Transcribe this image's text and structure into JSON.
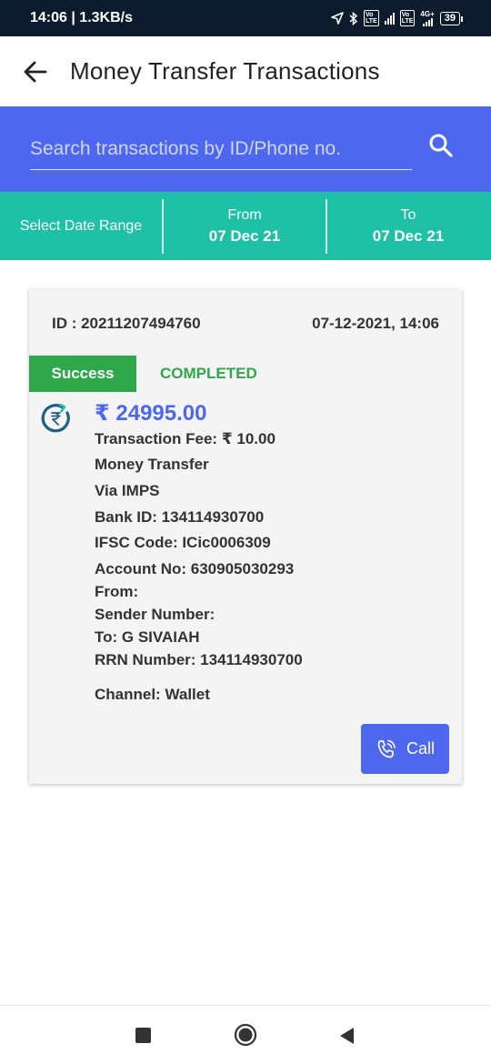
{
  "status_bar": {
    "time_speed": "14:06 | 1.3KB/s",
    "volte1": "Vo LTE",
    "net_4g": "4G+",
    "battery": "39"
  },
  "app_bar": {
    "title": "Money Transfer Transactions",
    "back_icon": "arrow-left-icon"
  },
  "search": {
    "placeholder": "Search transactions by ID/Phone no.",
    "value": "",
    "icon": "search-icon"
  },
  "date_range": {
    "select_label": "Select Date Range",
    "from_label": "From",
    "from_value": "07 Dec 21",
    "to_label": "To",
    "to_value": "07 Dec 21"
  },
  "transaction": {
    "id": "ID : 20211207494760",
    "datetime": "07-12-2021, 14:06",
    "status_badge": "Success",
    "status_text": "COMPLETED",
    "amount": "₹ 24995.00",
    "fee": "Transaction Fee: ₹ 10.00",
    "type": "Money Transfer",
    "via": "Via  IMPS",
    "bank_id": "Bank ID:  134114930700",
    "ifsc": "IFSC Code:  ICic0006309",
    "account": "Account No: 630905030293",
    "from": "From:",
    "sender": "Sender Number:",
    "to": "To:  G SIVAIAH",
    "rrn": "RRN Number:  134114930700",
    "channel": "Channel:  Wallet",
    "call_label": "Call"
  },
  "colors": {
    "primary": "#4d68ef",
    "teal": "#1ec0a6",
    "success": "#2ea84a",
    "status_bar": "#0d1b2e"
  }
}
